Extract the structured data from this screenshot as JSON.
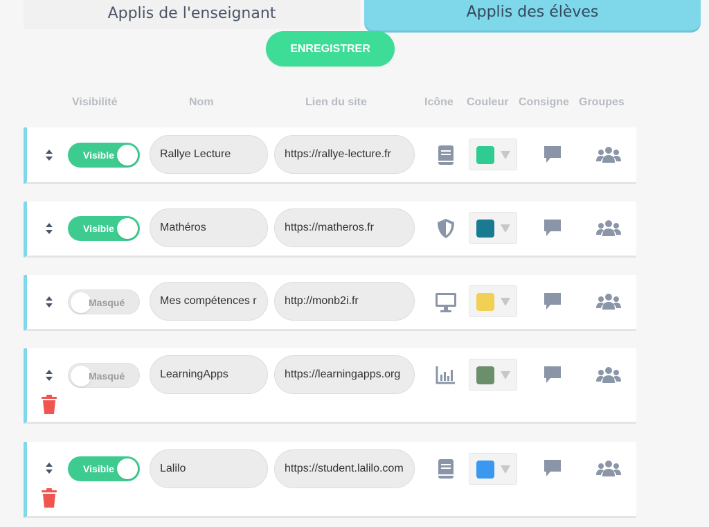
{
  "tabs": {
    "teacher": "Applis de l'enseignant",
    "students": "Applis des élèves"
  },
  "save_label": "ENREGISTRER",
  "columns": {
    "visibility": "Visibilité",
    "name": "Nom",
    "link": "Lien du site",
    "icon": "Icône",
    "color": "Couleur",
    "instruction": "Consigne",
    "groups": "Groupes"
  },
  "apps": [
    {
      "visibility": "Visible",
      "name": "Rallye Lecture",
      "url": "https://rallye-lecture.fr",
      "icon": "book-icon",
      "color": "#2ecc91",
      "deletable": false
    },
    {
      "visibility": "Visible",
      "name": "Mathéros",
      "url": "https://matheros.fr",
      "icon": "shield-icon",
      "color": "#1a7a92",
      "deletable": false
    },
    {
      "visibility": "Masqué",
      "name": "Mes compétences r",
      "url": "http://monb2i.fr",
      "icon": "desktop-icon",
      "color": "#f2cf55",
      "deletable": false
    },
    {
      "visibility": "Masqué",
      "name": "LearningApps",
      "url": "https://learningapps.org",
      "icon": "chart-icon",
      "color": "#6b8e6b",
      "deletable": true
    },
    {
      "visibility": "Visible",
      "name": "Lalilo",
      "url": "https://student.lalilo.com",
      "icon": "book-icon",
      "color": "#3a98f0",
      "deletable": true
    }
  ]
}
